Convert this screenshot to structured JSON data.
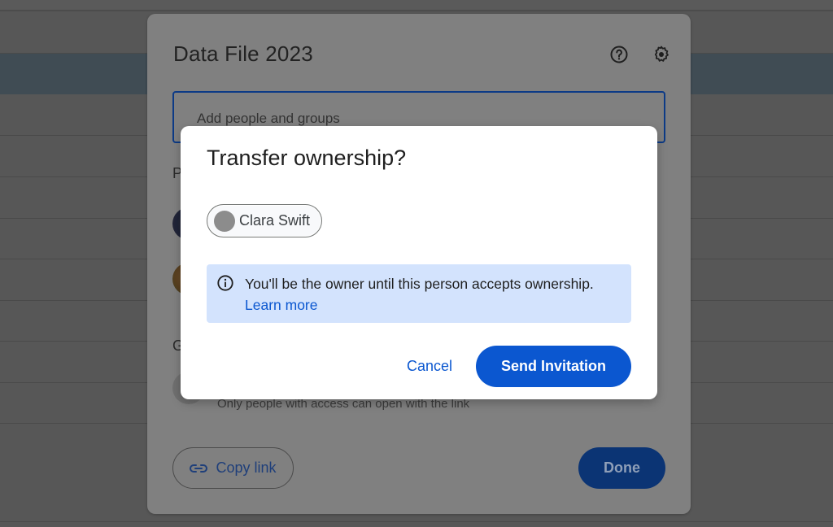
{
  "share_dialog": {
    "title": "Data File 2023",
    "help_icon": "help-circle-icon",
    "settings_icon": "gear-icon",
    "add_people_placeholder": "Add people and groups",
    "people_section_label": "P",
    "general_access_label": "G",
    "access_description": "Only people with access can open with the link",
    "copy_link_label": "Copy link",
    "copy_link_icon": "link-icon",
    "done_label": "Done"
  },
  "transfer_modal": {
    "title": "Transfer ownership?",
    "recipient": {
      "name": "Clara Swift"
    },
    "info": {
      "icon": "info-icon",
      "message": "You'll be the owner until this person accepts ownership.",
      "link_label": "Learn more"
    },
    "cancel_label": "Cancel",
    "send_label": "Send Invitation"
  },
  "colors": {
    "primary": "#0b57d0",
    "info_background": "#d3e3fd",
    "overlay_dim": "#808080"
  }
}
